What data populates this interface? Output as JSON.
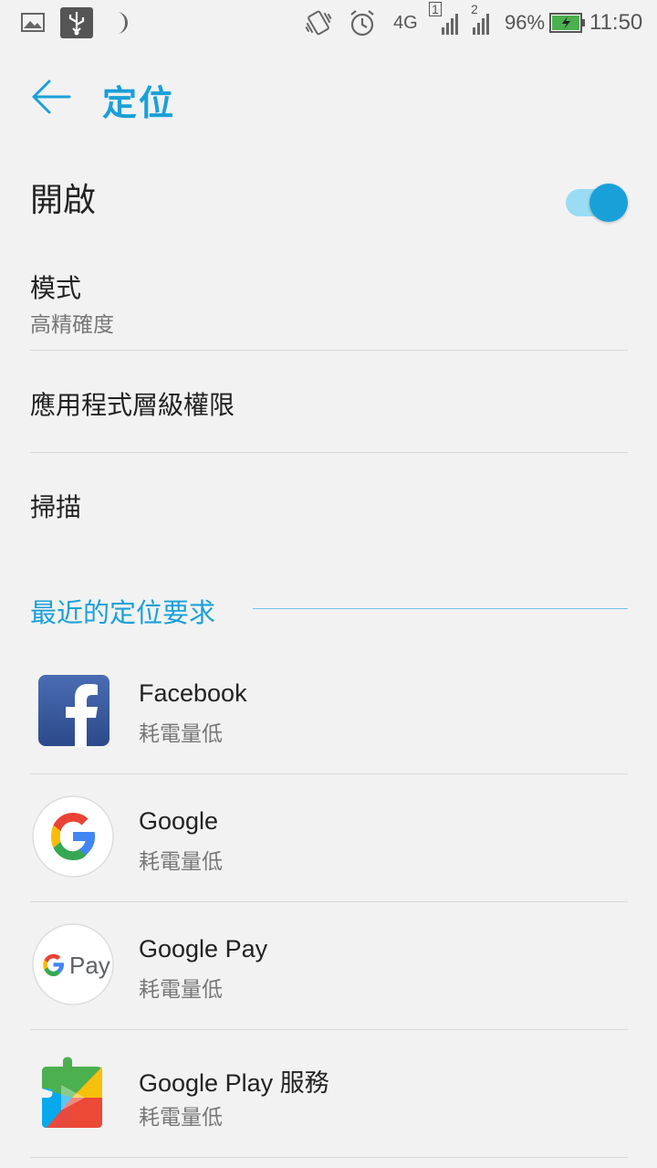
{
  "status_bar": {
    "network": "4G",
    "sim1": "1",
    "sim2": "2",
    "battery": "96%",
    "time": "11:50",
    "icons": [
      "image-icon",
      "usb-icon",
      "moon-icon",
      "vibrate-icon",
      "alarm-icon",
      "signal-icon",
      "battery-icon"
    ]
  },
  "header": {
    "title": "定位"
  },
  "location": {
    "label": "開啟",
    "enabled": true,
    "accent": "#1aa0d8"
  },
  "settings": [
    {
      "title": "模式",
      "subtitle": "高精確度"
    },
    {
      "title": "應用程式層級權限"
    },
    {
      "title": "掃描"
    }
  ],
  "recent": {
    "header": "最近的定位要求",
    "apps": [
      {
        "name": "Facebook",
        "detail": "耗電量低",
        "icon": "facebook-icon"
      },
      {
        "name": "Google",
        "detail": "耗電量低",
        "icon": "google-icon"
      },
      {
        "name": "Google Pay",
        "detail": "耗電量低",
        "icon": "google-pay-icon"
      },
      {
        "name": "Google Play 服務",
        "detail": "耗電量低",
        "icon": "google-play-services-icon"
      }
    ]
  }
}
